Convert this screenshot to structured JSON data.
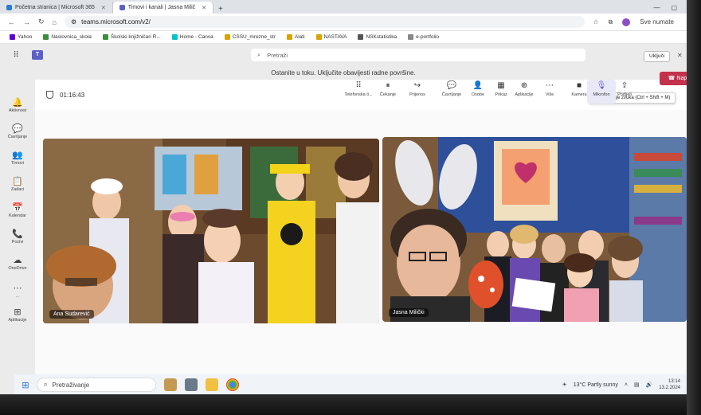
{
  "browser": {
    "tabs": [
      {
        "title": "Početna stranica | Microsoft 365",
        "active": false
      },
      {
        "title": "Timovi i kanali | Jasna Milič",
        "active": true
      }
    ],
    "url": "teams.microsoft.com/v2/",
    "profile_label": "Sve numate"
  },
  "bookmarks": [
    {
      "label": "Yahoo",
      "color": "#6001d2"
    },
    {
      "label": "Naslovnica_skola",
      "color": "#3a8f3a"
    },
    {
      "label": "Školski knjižničari R...",
      "color": "#3a8f3a"
    },
    {
      "label": "Home - Canva",
      "color": "#00c4cc"
    },
    {
      "label": "CSSU_mrezne_str",
      "color": "#d9a400"
    },
    {
      "label": "Alati",
      "color": "#d9a400"
    },
    {
      "label": "NASTAVA",
      "color": "#d9a400"
    },
    {
      "label": "NSKstatistika",
      "color": "#555555"
    },
    {
      "label": "e-portfolio",
      "color": "#888888"
    }
  ],
  "teams": {
    "search_placeholder": "Pretraži",
    "signin_label": "Uključi",
    "notice": "Ostanite u toku. Uključite obavijesti radne površine.",
    "rail": [
      {
        "label": "Aktivnost",
        "icon": "bell-icon",
        "glyph": "🔔"
      },
      {
        "label": "Čavrljanje",
        "icon": "chat-icon",
        "glyph": "💬"
      },
      {
        "label": "Timovi",
        "icon": "teams-icon",
        "glyph": "👥"
      },
      {
        "label": "Zadaci",
        "icon": "assignments-icon",
        "glyph": "📋"
      },
      {
        "label": "Kalendar",
        "icon": "calendar-icon",
        "glyph": "📅"
      },
      {
        "label": "Pozivi",
        "icon": "phone-icon",
        "glyph": "📞"
      },
      {
        "label": "OneDrive",
        "icon": "cloud-icon",
        "glyph": "☁"
      },
      {
        "label": "...",
        "icon": "more-icon",
        "glyph": "⋯"
      },
      {
        "label": "Aplikacije",
        "icon": "apps-icon",
        "glyph": "⊞"
      }
    ],
    "meeting": {
      "timer": "01:16:43",
      "toolbar": [
        {
          "label": "Telefonska ti...",
          "icon": "dialpad-icon",
          "glyph": "⠿"
        },
        {
          "label": "Čekanje",
          "icon": "hold-icon",
          "glyph": "⏸"
        },
        {
          "label": "Prijenos",
          "icon": "transfer-icon",
          "glyph": "↪"
        },
        {
          "label": "Čavrljanje",
          "icon": "chat-icon",
          "glyph": "💬"
        },
        {
          "label": "Osobe",
          "icon": "people-icon",
          "glyph": "👤"
        },
        {
          "label": "Prikaz",
          "icon": "view-icon",
          "glyph": "▦"
        },
        {
          "label": "Aplikacije",
          "icon": "add-app-icon",
          "glyph": "⊕"
        },
        {
          "label": "Više",
          "icon": "more-icon",
          "glyph": "⋯"
        },
        {
          "label": "Kamera",
          "icon": "camera-icon",
          "glyph": "■"
        },
        {
          "label": "Mikrofon",
          "icon": "mic-icon",
          "glyph": "🎙"
        },
        {
          "label": "Podijeli",
          "icon": "share-icon",
          "glyph": "⇪"
        }
      ],
      "leave_label": "Napusti",
      "mic_tooltip": "Isključivanje zvuka (Ctrl + Shift + M)",
      "participants": [
        {
          "name": "Ana Sudarević"
        },
        {
          "name": "Jasna Milički"
        }
      ]
    }
  },
  "taskbar": {
    "search_placeholder": "Pretraživanje",
    "weather": "13°C  Partly sunny",
    "time": "13:14",
    "date": "13.2.2024"
  }
}
